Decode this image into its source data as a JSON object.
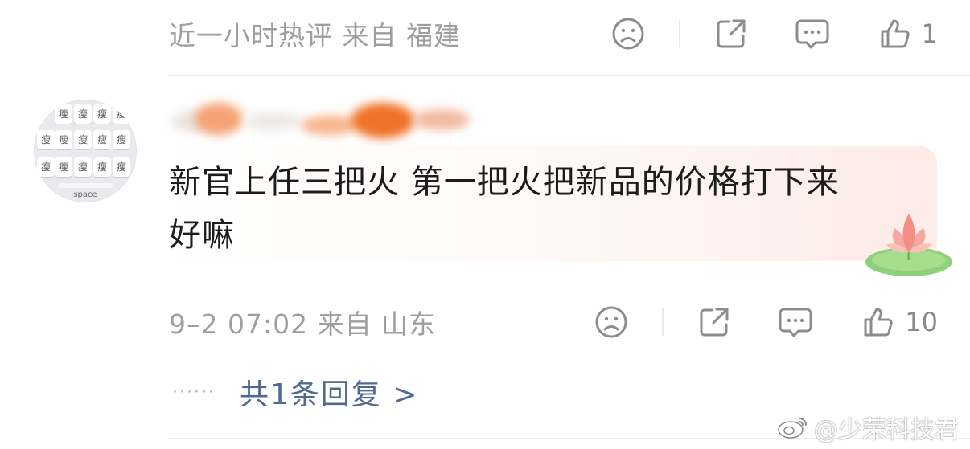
{
  "top_comment": {
    "meta": "近一小时热评  来自 福建",
    "likes": "1"
  },
  "comment": {
    "avatar_keys": [
      "瘦",
      "瘦",
      "瘦",
      "瘦",
      "瘦",
      "瘦",
      "瘦",
      "瘦",
      "瘦",
      "瘦",
      "瘦",
      "瘦",
      "瘦",
      "瘦",
      "瘦",
      "瘦"
    ],
    "avatar_space_label": "space",
    "text_line1": "新官上任三把火 第一把火把新品的价格打下来",
    "text_line2": "好嘛",
    "meta": "9–2 07:02  来自 山东",
    "likes": "10"
  },
  "replies": {
    "dots": "······",
    "label": "共1条回复 >"
  },
  "watermark": {
    "text": "@少荣科技君"
  },
  "icons": [
    "sad-face-icon",
    "share-icon",
    "comment-icon",
    "thumbs-up-icon",
    "lotus-icon",
    "weibo-logo-icon"
  ]
}
